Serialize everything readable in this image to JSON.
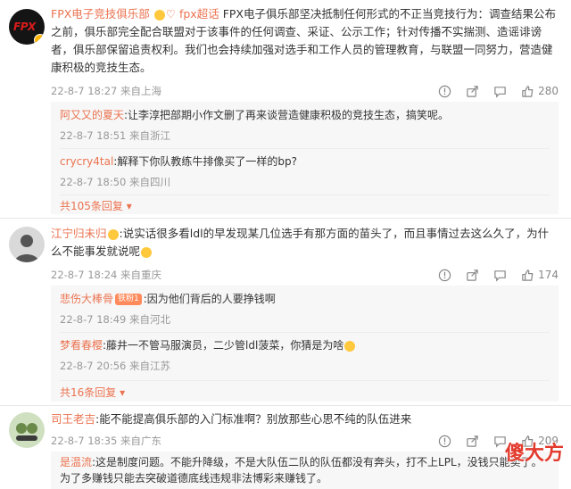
{
  "comments": [
    {
      "user": "FPX电子竞技俱乐部",
      "mention": "fpx超话",
      "text": "FPX电子俱乐部坚决抵制任何形式的不正当竞技行为：调查结果公布之前，俱乐部完全配合联盟对于该事件的任何调查、采证、公示工作；针对传播不实揣测、造谣诽谤者，俱乐部保留追责权利。我们也会持续加强对选手和工作人员的管理教育，与联盟一同努力，营造健康积极的竞技生态。",
      "time": "22-8-7 18:27 来自上海",
      "likes": "280",
      "replies": [
        {
          "user": "阿又又的夏天",
          "text": ":让李淳把部期小作文删了再来谈营造健康积极的竞技生态，搞笑呢。",
          "meta": "22-8-7 18:51 来自浙江"
        },
        {
          "user": "crycry4tal",
          "text": ":解释下你队教练牛排像买了一样的bp?",
          "meta": "22-8-7 18:50 来自四川"
        }
      ],
      "more": "共105条回复"
    },
    {
      "user": "江宁归未归",
      "text": ":说实话很多看ldl的早发现某几位选手有那方面的苗头了，而且事情过去这么久了，为什么不能事发就说呢",
      "time": "22-8-7 18:24 来自重庆",
      "likes": "174",
      "replies": [
        {
          "user": "悲伤大棒骨",
          "badge": "铁粉1",
          "text": ":因为他们背后的人要挣钱啊",
          "meta": "22-8-7 18:49 来自河北"
        },
        {
          "user": "梦看春樱",
          "text": ":藤井一不管马服演员，二少管ldl菠菜，你猜是为啥",
          "meta": "22-8-7 20:56 来自江苏"
        }
      ],
      "more": "共16条回复"
    },
    {
      "user": "司王老吉",
      "text": ":能不能提高俱乐部的入门标准啊？别放那些心思不纯的队伍进来",
      "time": "22-8-7 18:35 来自广东",
      "likes": "209",
      "replies": [
        {
          "user": "是温流",
          "text": ":这是制度问题。不能升降级，不是大队伍二队的队伍都没有奔头，打不上LPL，没钱只能卖了。为了多赚钱只能去突破道德底线违规非法博彩来赚钱了。",
          "meta": ""
        }
      ]
    }
  ],
  "watermark": "傻大方",
  "colors": {
    "accent": "#eb7350",
    "meta": "#999999",
    "reply_bg": "#f7f7f7"
  }
}
